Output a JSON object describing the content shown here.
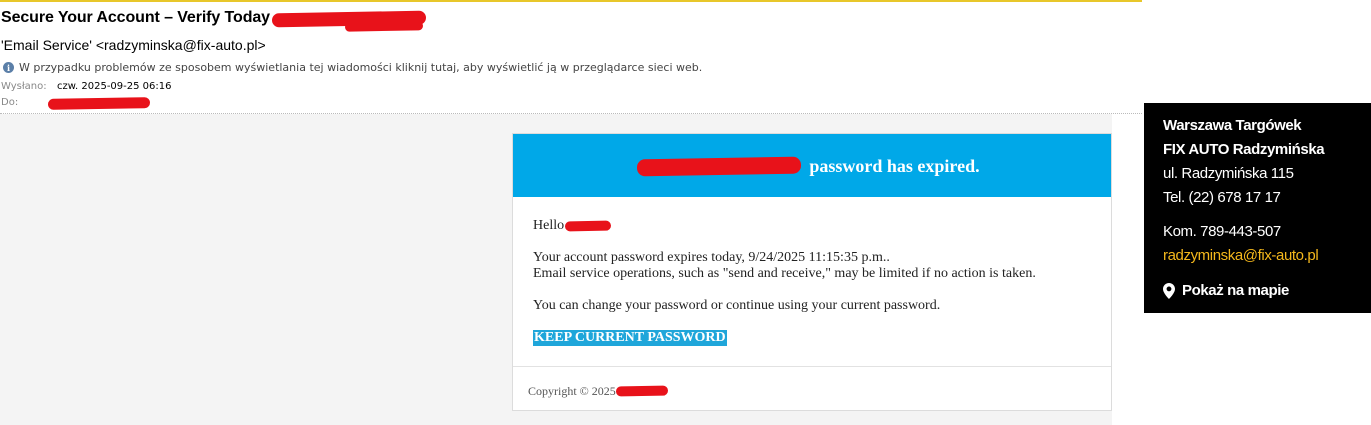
{
  "email": {
    "subject": "Secure Your Account – Verify Today",
    "sender": "'Email Service' <radzyminska@fix-auto.pl>",
    "info_bar": "W przypadku problemów ze sposobem wyświetlania tej wiadomości kliknij tutaj, aby wyświetlić ją w przeglądarce sieci web.",
    "sent_label": "Wysłano:",
    "sent_value": "czw. 2025-09-25 06:16",
    "to_label": "Do:"
  },
  "message": {
    "banner_text": "password has expired.",
    "greeting": "Hello",
    "line1": "Your account password expires today, 9/24/2025 11:15:35 p.m..",
    "line2": "Email service operations, such as \"send and receive,\" may be limited if no action is taken.",
    "line3": "You can change your password or continue using your current password.",
    "button_label": "KEEP CURRENT PASSWORD",
    "copyright": "Copyright © 2025"
  },
  "signature": {
    "line1": "Warszawa Targówek",
    "line2": "FIX AUTO Radzymińska",
    "address": "ul. Radzymińska 115",
    "phone": "Tel. (22) 678 17 17",
    "mobile": "Kom. 789-443-507",
    "email": "radzyminska@fix-auto.pl",
    "map_link": "Pokaż na mapie"
  },
  "colors": {
    "banner": "#00a8e8",
    "button": "#1fa6da",
    "redaction": "#e8121a",
    "signature_bg": "#000000",
    "signature_email": "#f5b81c"
  },
  "icons": [
    "info-icon",
    "map-pin-icon"
  ]
}
